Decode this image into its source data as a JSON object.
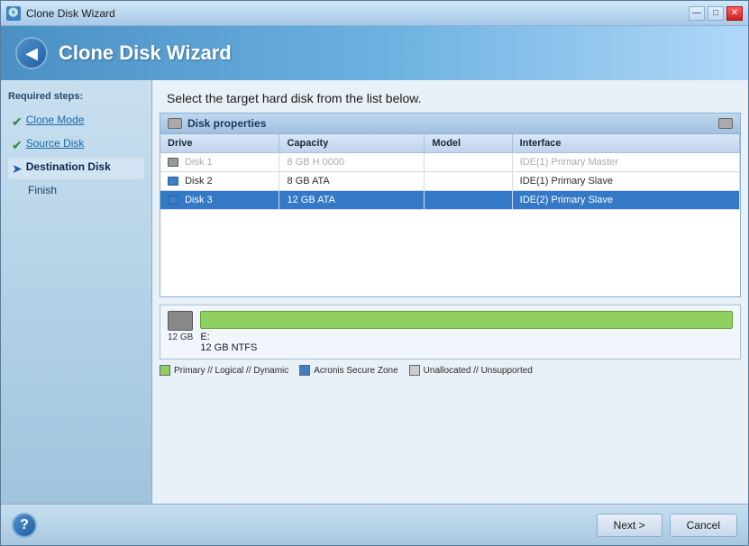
{
  "window": {
    "title": "Clone Disk Wizard",
    "titlebar_buttons": {
      "minimize": "—",
      "maximize": "□",
      "close": "✕"
    }
  },
  "header": {
    "back_icon": "◀",
    "title": "Clone Disk Wizard"
  },
  "sidebar": {
    "heading": "Required steps:",
    "items": [
      {
        "id": "clone-mode",
        "label": "Clone Mode",
        "status": "done"
      },
      {
        "id": "source-disk",
        "label": "Source Disk",
        "status": "done"
      },
      {
        "id": "destination-disk",
        "label": "Destination Disk",
        "status": "active"
      },
      {
        "id": "finish",
        "label": "Finish",
        "status": "none"
      }
    ]
  },
  "main": {
    "instruction": "Select the target hard disk from the list below.",
    "disk_properties": {
      "title": "Disk properties",
      "columns": [
        "Drive",
        "Capacity",
        "Model",
        "Interface"
      ],
      "disks": [
        {
          "name": "Disk 1",
          "capacity": "8 GB H 0000",
          "model": "",
          "interface": "IDE(1) Primary Master",
          "status": "disabled"
        },
        {
          "name": "Disk 2",
          "capacity": "8 GB ATA",
          "model": "",
          "interface": "IDE(1) Primary Slave",
          "status": "normal"
        },
        {
          "name": "Disk 3",
          "capacity": "12 GB ATA",
          "model": "",
          "interface": "IDE(2) Primary Slave",
          "status": "selected"
        }
      ]
    },
    "selected_disk": {
      "size_label": "12 GB",
      "partition_label": "E:",
      "partition_detail": "12 GB  NTFS"
    },
    "legend": [
      {
        "type": "green",
        "label": "Primary // Logical // Dynamic"
      },
      {
        "type": "blue",
        "label": "Acronis Secure Zone"
      },
      {
        "type": "gray",
        "label": "Unallocated // Unsupported"
      }
    ]
  },
  "footer": {
    "help_icon": "?",
    "next_button": "Next >",
    "cancel_button": "Cancel"
  }
}
